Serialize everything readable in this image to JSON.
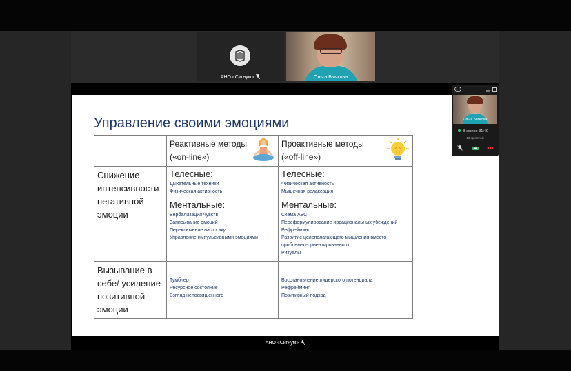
{
  "participants": [
    {
      "name": "АНО «Сигнум»"
    },
    {
      "name": "Ольга Бычкова"
    }
  ],
  "slide": {
    "title": "Управление своими эмоциями",
    "columns": [
      {
        "line1": "Реактивные методы",
        "line2": "(«on-line»)"
      },
      {
        "line1": "Проактивные методы",
        "line2": "(«off-line»)"
      }
    ],
    "rows": [
      {
        "label_lines": [
          "Снижение",
          "интенсивности",
          "негативной",
          "эмоции"
        ],
        "reactive": {
          "group1": "Телесные:",
          "group1_items": [
            "Дыхательные техники",
            "Физическая активность"
          ],
          "group2": "Ментальные:",
          "group2_items": [
            "Вербализация чувств",
            "Записывание эмоций",
            "Переключение на логику",
            "Управление импульсивными эмоциями"
          ]
        },
        "proactive": {
          "group1": "Телесные:",
          "group1_items": [
            "Физическая активность",
            "Мышечная релаксация"
          ],
          "group2": "Ментальные:",
          "group2_items": [
            "Схема АВС",
            "Переформулирование иррациональных убеждений",
            "Рефрейминг",
            "Развитие целеполагающего мышления вместо",
            "проблемно-ориентированного",
            "Ритуалы"
          ]
        }
      },
      {
        "label_lines": [
          "Вызывание в",
          "себе/ усиление",
          "позитивной",
          "эмоции"
        ],
        "reactive_items": [
          "Тумблер",
          "Ресурсное состояние",
          "Взгляд непосвященного"
        ],
        "proactive_items": [
          "Восстановление лидерского потенциала",
          "Рефрейминг",
          "Позитивный подход"
        ]
      }
    ]
  },
  "presenter_label": "АНО «Сигнум»",
  "popup": {
    "name": "Ольга Бычкова",
    "live": "В эфире 31:49",
    "viewers": "13 зрителей"
  },
  "colors": {
    "title": "#1f3864",
    "items": "#1f3864",
    "live_dot": "#3bd16f"
  },
  "icons": [
    "sigma-logo-icon",
    "mic-off-icon",
    "meditation-illustration",
    "lightbulb-illustration",
    "minimize-icon",
    "expand-icon",
    "camera-icon",
    "end-call-icon"
  ]
}
